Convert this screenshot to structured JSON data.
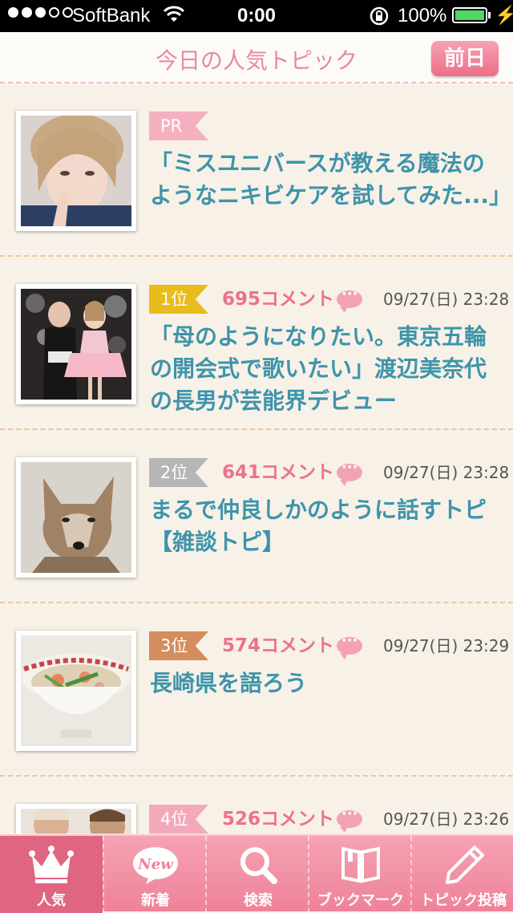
{
  "status_bar": {
    "carrier": "SoftBank",
    "time": "0:00",
    "battery": "100%",
    "battery_level": 1.0,
    "signal_bars": 3
  },
  "header": {
    "title": "今日の人気トピック",
    "prev_button": "前日"
  },
  "topics": [
    {
      "tag": "PR",
      "comments": "",
      "date": "",
      "title": "「ミスユニバースが教える魔法のようなニキビケアを試してみた...」"
    },
    {
      "tag": "1位",
      "comments": "695コメント",
      "date": "09/27(日) 23:28",
      "title": "「母のようになりたい。東京五輪の開会式で歌いたい」渡辺美奈代の長男が芸能界デビュー"
    },
    {
      "tag": "2位",
      "comments": "641コメント",
      "date": "09/27(日) 23:28",
      "title": "まるで仲良しかのように話すトピ【雑談トピ】"
    },
    {
      "tag": "3位",
      "comments": "574コメント",
      "date": "09/27(日) 23:29",
      "title": "長崎県を語ろう"
    },
    {
      "tag": "4位",
      "comments": "526コメント",
      "date": "09/27(日) 23:26",
      "title": ""
    }
  ],
  "tab_bar": {
    "tabs": [
      {
        "label": "人気",
        "icon": "crown-icon",
        "active": true
      },
      {
        "label": "新着",
        "icon": "new-bubble-icon",
        "badge": "New",
        "active": false
      },
      {
        "label": "検索",
        "icon": "search-icon",
        "active": false
      },
      {
        "label": "ブックマーク",
        "icon": "book-icon",
        "active": false
      },
      {
        "label": "トピック投稿",
        "icon": "pencil-icon",
        "active": false
      }
    ]
  },
  "colors": {
    "accent_pink": "#ee8299",
    "title_blue": "#3e94aa",
    "comment_red": "#ec7386",
    "rank1_gold": "#e8bc1c",
    "rank2_gray": "#b6b6b6",
    "rank3_bronze": "#d48d5d"
  }
}
